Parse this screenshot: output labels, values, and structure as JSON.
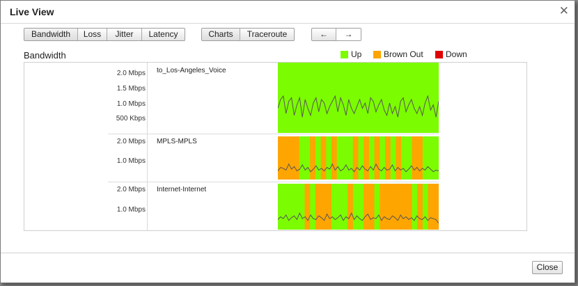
{
  "dialog": {
    "title": "Live View",
    "close_label": "Close"
  },
  "toolbar": {
    "metric_tabs": [
      "Bandwidth",
      "Loss",
      "Jitter",
      "Latency"
    ],
    "view_tabs": [
      "Charts",
      "Traceroute"
    ],
    "nav": {
      "back_icon": "left-arrow-icon",
      "forward_icon": "right-arrow-icon",
      "back_glyph": "←",
      "forward_glyph": "→"
    }
  },
  "section_title": "Bandwidth",
  "legend": [
    {
      "label": "Up",
      "color": "#7cfc00"
    },
    {
      "label": "Brown Out",
      "color": "#ffa500"
    },
    {
      "label": "Down",
      "color": "#e00000"
    }
  ],
  "chart_data": [
    {
      "type": "line",
      "name": "to_Los-Angeles_Voice",
      "y_ticks": [
        "2.0 Mbps",
        "1.5 Mbps",
        "1.0 Mbps",
        "500 Kbps"
      ],
      "ylim_mbps": [
        0,
        2.0
      ],
      "status": [
        "Up",
        "Up",
        "Up",
        "Up",
        "Up",
        "Up",
        "Up",
        "Up",
        "Up",
        "Up",
        "Up",
        "Up",
        "Up",
        "Up",
        "Up",
        "Up",
        "Up",
        "Up",
        "Up",
        "Up",
        "Up",
        "Up",
        "Up",
        "Up",
        "Up",
        "Up",
        "Up",
        "Up",
        "Up",
        "Up"
      ],
      "values_mbps": [
        0.7,
        0.95,
        1.05,
        0.55,
        0.9,
        1.0,
        0.5,
        0.8,
        1.0,
        0.45,
        0.95,
        0.7,
        0.5,
        0.85,
        1.0,
        0.6,
        0.95,
        0.85,
        0.55,
        0.75,
        0.9,
        1.05,
        0.6,
        1.0,
        0.8,
        0.5,
        0.95,
        0.7,
        0.55,
        0.75,
        0.95,
        0.7,
        0.85,
        0.55,
        1.0,
        0.9,
        0.6,
        0.8,
        0.95,
        0.65,
        0.5,
        0.85,
        0.55,
        0.75,
        0.45,
        0.9,
        1.0,
        0.6,
        0.8,
        0.95,
        0.7,
        0.55,
        0.75,
        0.5,
        0.85,
        1.05,
        0.65,
        0.8,
        0.45,
        0.9
      ]
    },
    {
      "type": "line",
      "name": "MPLS-MPLS",
      "y_ticks": [
        "2.0 Mbps",
        "1.0 Mbps"
      ],
      "ylim_mbps": [
        0,
        2.5
      ],
      "status": [
        "Brown Out",
        "Brown Out",
        "Brown Out",
        "Brown Out",
        "Up",
        "Up",
        "Brown Out",
        "Up",
        "Brown Out",
        "Up",
        "Brown Out",
        "Up",
        "Up",
        "Up",
        "Brown Out",
        "Up",
        "Brown Out",
        "Up",
        "Brown Out",
        "Up",
        "Brown Out",
        "Up",
        "Brown Out",
        "Up",
        "Up",
        "Brown Out",
        "Brown Out",
        "Up",
        "Up",
        "Up"
      ],
      "values_mbps": [
        0.5,
        0.7,
        0.65,
        0.55,
        0.9,
        0.6,
        0.75,
        0.5,
        0.6,
        0.85,
        0.55,
        0.7,
        0.45,
        0.6,
        0.8,
        0.55,
        0.65,
        0.5,
        0.7,
        0.6,
        0.9,
        0.55,
        0.75,
        0.5,
        0.6,
        0.85,
        0.55,
        0.65,
        0.45,
        0.7,
        0.55,
        0.8,
        0.6,
        0.5,
        0.75,
        0.55,
        0.9,
        0.6,
        0.5,
        0.7,
        0.55,
        0.6,
        0.85,
        0.5,
        0.7,
        0.55,
        0.65,
        0.45,
        0.6,
        0.8,
        0.55,
        0.7,
        0.5,
        0.65,
        0.55,
        0.75,
        0.6,
        0.45,
        0.55,
        0.5
      ]
    },
    {
      "type": "line",
      "name": "Internet-Internet",
      "y_ticks": [
        "2.0 Mbps",
        "1.0 Mbps"
      ],
      "ylim_mbps": [
        0,
        2.5
      ],
      "status": [
        "Up",
        "Up",
        "Up",
        "Up",
        "Up",
        "Brown Out",
        "Up",
        "Brown Out",
        "Brown Out",
        "Brown Out",
        "Up",
        "Up",
        "Up",
        "Brown Out",
        "Up",
        "Up",
        "Brown Out",
        "Brown Out",
        "Up",
        "Brown Out",
        "Brown Out",
        "Brown Out",
        "Brown Out",
        "Brown Out",
        "Brown Out",
        "Up",
        "Brown Out",
        "Up",
        "Brown Out",
        "Brown Out"
      ],
      "values_mbps": [
        0.55,
        0.7,
        0.6,
        0.8,
        0.5,
        0.65,
        0.75,
        0.55,
        0.9,
        0.6,
        0.7,
        0.5,
        0.8,
        0.6,
        0.55,
        0.75,
        0.65,
        0.5,
        0.85,
        0.6,
        0.7,
        0.55,
        0.65,
        0.8,
        0.5,
        0.7,
        0.6,
        0.9,
        0.55,
        0.75,
        0.6,
        0.5,
        0.7,
        0.85,
        0.55,
        0.65,
        0.6,
        0.8,
        0.5,
        0.7,
        0.6,
        0.55,
        0.75,
        0.65,
        0.5,
        0.8,
        0.6,
        0.7,
        0.55,
        0.65,
        0.5,
        0.75,
        0.6,
        0.55,
        0.7,
        0.5,
        0.65,
        0.6,
        0.55,
        0.35
      ]
    }
  ]
}
